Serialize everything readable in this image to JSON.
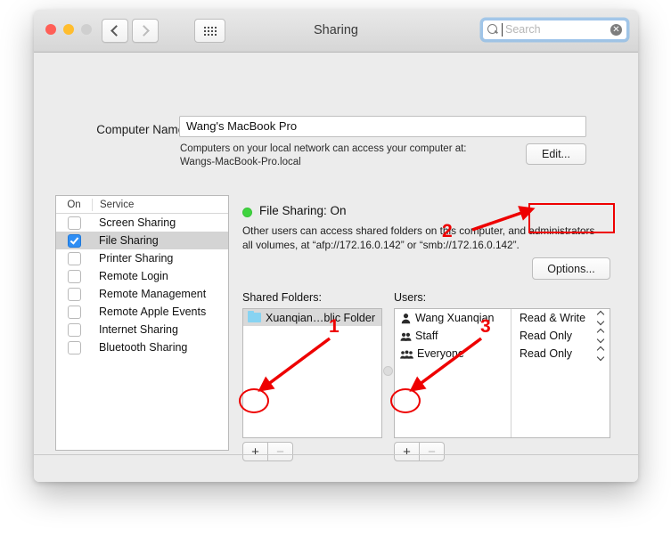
{
  "window": {
    "title": "Sharing",
    "traffic_lights": [
      "close",
      "minimize",
      "zoom"
    ],
    "nav_back": "back-chevron",
    "nav_forward": "forward-chevron",
    "show_all": "grid-icon"
  },
  "search": {
    "placeholder": "Search",
    "value": "",
    "icon": "search-icon",
    "clear_glyph": "✕"
  },
  "computer_name": {
    "label": "Computer Name:",
    "value": "Wang's MacBook Pro",
    "description_line1": "Computers on your local network can access your computer at:",
    "description_line2": "Wangs-MacBook-Pro.local",
    "edit_button": "Edit..."
  },
  "services": {
    "col_on": "On",
    "col_service": "Service",
    "items": [
      {
        "name": "Screen Sharing",
        "checked": false,
        "selected": false
      },
      {
        "name": "File Sharing",
        "checked": true,
        "selected": true
      },
      {
        "name": "Printer Sharing",
        "checked": false,
        "selected": false
      },
      {
        "name": "Remote Login",
        "checked": false,
        "selected": false
      },
      {
        "name": "Remote Management",
        "checked": false,
        "selected": false
      },
      {
        "name": "Remote Apple Events",
        "checked": false,
        "selected": false
      },
      {
        "name": "Internet Sharing",
        "checked": false,
        "selected": false
      },
      {
        "name": "Bluetooth Sharing",
        "checked": false,
        "selected": false
      }
    ]
  },
  "detail": {
    "status_title": "File Sharing: On",
    "status_color": "#3fd43f",
    "status_description_line1": "Other users can access shared folders on this computer, and administrators",
    "status_description_line2": "all volumes, at “afp://172.16.0.142” or “smb://172.16.0.142”.",
    "options_button": "Options...",
    "shared_folders_label": "Shared Folders:",
    "users_label": "Users:",
    "shared_folders": [
      {
        "name": "Xuanqian…blic Folder",
        "icon": "folder-icon",
        "selected": true
      }
    ],
    "users": [
      {
        "name": "Wang Xuanqian",
        "icon": "single-user-icon",
        "permission": "Read & Write"
      },
      {
        "name": "Staff",
        "icon": "group-users-icon",
        "permission": "Read Only"
      },
      {
        "name": "Everyone",
        "icon": "everyone-users-icon",
        "permission": "Read Only"
      }
    ],
    "add_glyph": "+",
    "remove_glyph": "−"
  },
  "footer": {
    "help_glyph": "?"
  },
  "annotations": {
    "color": "#ee0000",
    "markers": [
      {
        "id": "1",
        "target": "add-shared-folder-button"
      },
      {
        "id": "2",
        "target": "options-button"
      },
      {
        "id": "3",
        "target": "add-user-button"
      }
    ]
  }
}
